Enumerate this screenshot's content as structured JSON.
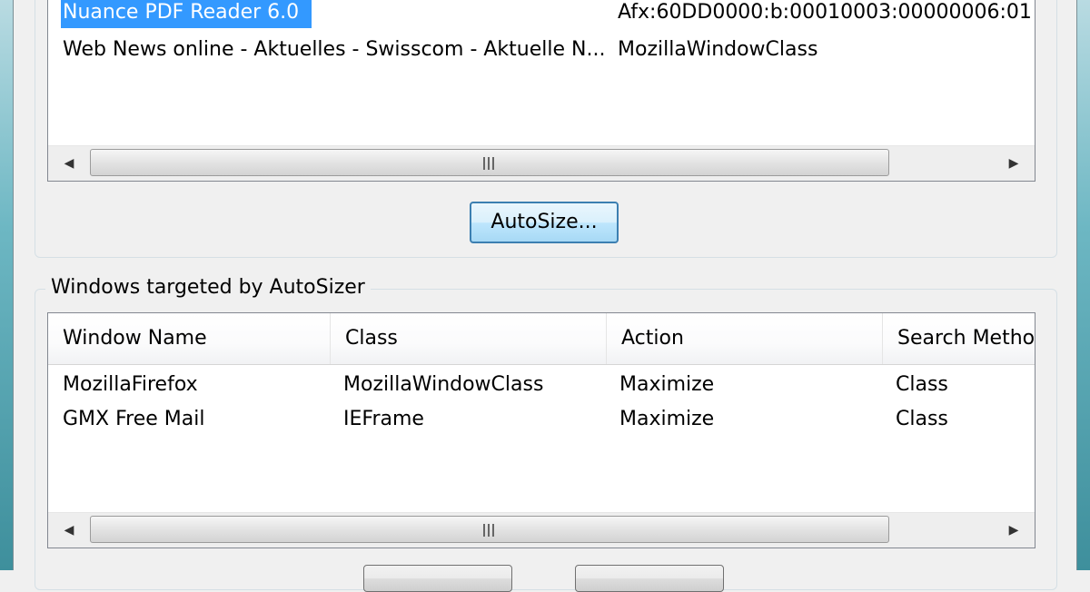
{
  "top_list": {
    "rows": [
      {
        "window_name": "Nuance PDF Reader 6.0",
        "class": "Afx:60DD0000:b:00010003:00000006:01",
        "selected": true
      },
      {
        "window_name": "Web News online - Aktuelles - Swisscom - Aktuelle N...",
        "class": "MozillaWindowClass",
        "selected": false
      }
    ]
  },
  "autosize_button": {
    "label": "AutoSize..."
  },
  "targeted_group": {
    "legend": "Windows targeted by AutoSizer",
    "columns": [
      "Window Name",
      "Class",
      "Action",
      "Search Metho"
    ],
    "rows": [
      {
        "window_name": "MozillaFirefox",
        "class": "MozillaWindowClass",
        "action": "Maximize",
        "search_method": "Class"
      },
      {
        "window_name": "GMX Free Mail",
        "class": "IEFrame",
        "action": "Maximize",
        "search_method": "Class"
      }
    ]
  },
  "icons": {
    "scroll_left": "◀",
    "scroll_right": "▶"
  }
}
